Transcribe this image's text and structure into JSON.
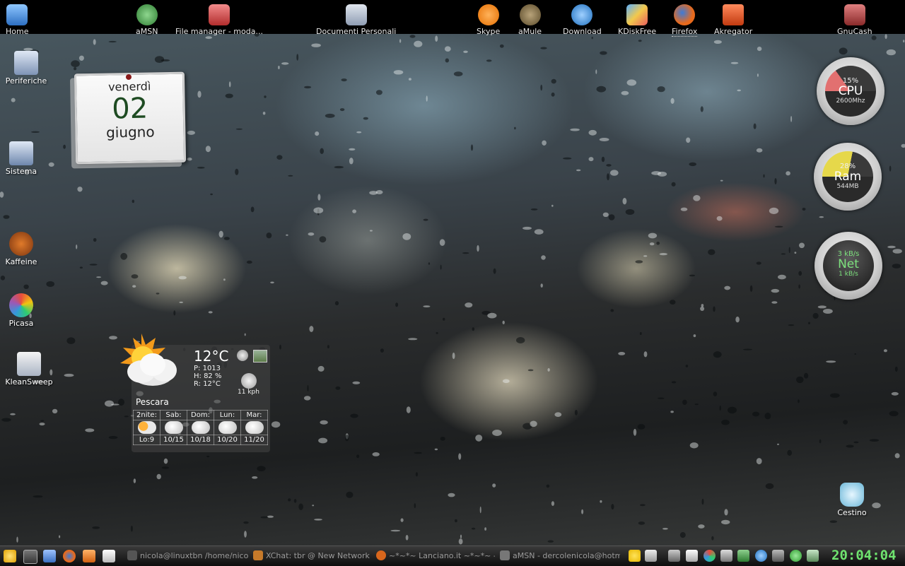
{
  "top_icons": [
    {
      "label": "Home",
      "icon": "home-icon"
    },
    {
      "label": "aMSN",
      "icon": "amsn-icon"
    },
    {
      "label": "File manager - moda...",
      "icon": "file-manager-icon"
    },
    {
      "label": "Documenti Personali",
      "icon": "documents-icon"
    },
    {
      "label": "Skype",
      "icon": "skype-icon"
    },
    {
      "label": "aMule",
      "icon": "amule-icon"
    },
    {
      "label": "Download",
      "icon": "download-icon"
    },
    {
      "label": "KDiskFree",
      "icon": "kdiskfree-icon"
    },
    {
      "label": "Firefox",
      "icon": "firefox-icon"
    },
    {
      "label": "Akregator",
      "icon": "akregator-icon"
    },
    {
      "label": "GnuCash",
      "icon": "gnucash-icon"
    }
  ],
  "left_icons": [
    {
      "label": "Periferiche",
      "icon": "computer-icon"
    },
    {
      "label": "Sistema",
      "icon": "system-icon"
    },
    {
      "label": "Kaffeine",
      "icon": "kaffeine-icon"
    },
    {
      "label": "Picasa",
      "icon": "picasa-icon"
    },
    {
      "label": "KleanSweep",
      "icon": "kleansweep-icon"
    }
  ],
  "trash": {
    "label": "Cestino",
    "icon": "trash-icon"
  },
  "calendar": {
    "weekday": "venerdì",
    "day": "02",
    "month": "giugno"
  },
  "gauges": {
    "cpu": {
      "percent": "15%",
      "label": "CPU",
      "sub": "2600Mhz",
      "value": 0.15,
      "color": "#e27070"
    },
    "ram": {
      "percent": "28%",
      "label": "Ram",
      "sub": "544MB",
      "value": 0.28,
      "color": "#e6d84a"
    },
    "net": {
      "down": "3 kB/s",
      "label": "Net",
      "up": "1 kB/s",
      "color": "#7de07d"
    }
  },
  "weather": {
    "temp": "12°C",
    "pressure": "P:  1013",
    "humidity": "H:  82 %",
    "realfeel": "R:  12°C",
    "wind": "11 kph",
    "city": "Pescara",
    "forecast": [
      {
        "day": "2nite:",
        "temps": "Lo:9"
      },
      {
        "day": "Sab:",
        "temps": "10/15"
      },
      {
        "day": "Dom:",
        "temps": "10/18"
      },
      {
        "day": "Lun:",
        "temps": "10/20"
      },
      {
        "day": "Mar:",
        "temps": "11/20"
      }
    ]
  },
  "taskbar": {
    "tasks": [
      {
        "label": "nicola@linuxtbn /home/nicol",
        "icon": "terminal-icon"
      },
      {
        "label": "XChat: tbr @ New Network /",
        "icon": "xchat-icon"
      },
      {
        "label": "~*~*~ Lanciano.it ~*~*~ - I",
        "icon": "firefox-icon"
      },
      {
        "label": "aMSN - dercolenicola@hotm",
        "icon": "amsn-icon"
      }
    ],
    "clock": "20:04:04"
  }
}
